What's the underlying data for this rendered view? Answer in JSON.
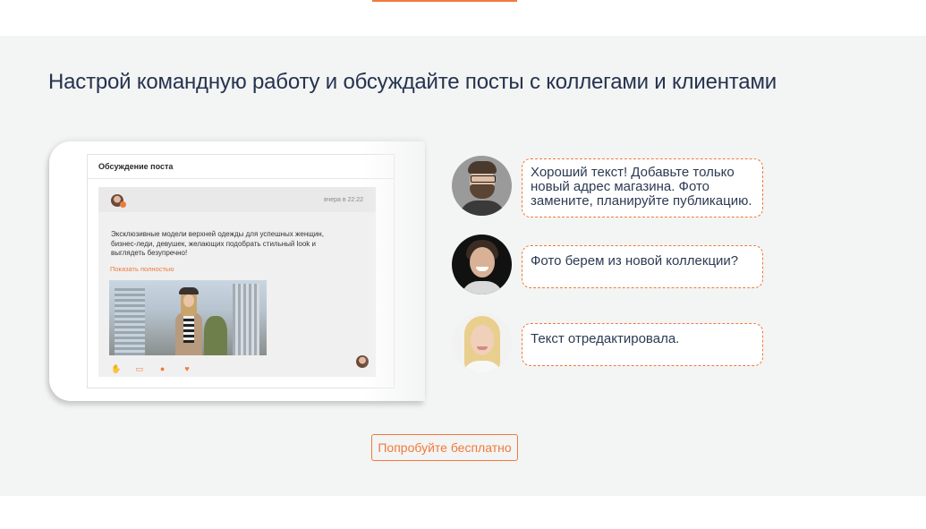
{
  "section": {
    "headline": "Настрой командную работу и обсуждайте посты с коллегами и клиентами",
    "cta_label": "Попробуйте бесплатно"
  },
  "mockup": {
    "panel_title": "Обсуждение поста",
    "post_time": "вчера в 22:22",
    "post_text": "Эксклюзивные модели верхней одежды для успешных женщин, бизнес-леди, девушек, желающих подобрать стильный look и выглядеть безупречно!",
    "show_more": "Показать полностью",
    "action_icons": [
      "like-icon",
      "repost-icon",
      "comment-icon",
      "heart-icon"
    ]
  },
  "chat": [
    {
      "avatar": "bearded-man-avatar",
      "text": "Хороший текст! Добавьте только новый адрес магазина. Фото замените, планируйте публикацию."
    },
    {
      "avatar": "smiling-man-avatar",
      "text": "Фото берем из новой коллекции?"
    },
    {
      "avatar": "blonde-woman-avatar",
      "text": "Текст отредактировала."
    }
  ],
  "colors": {
    "accent": "#f07a3b",
    "heading": "#25334f",
    "section_bg": "#f3f4f4"
  }
}
